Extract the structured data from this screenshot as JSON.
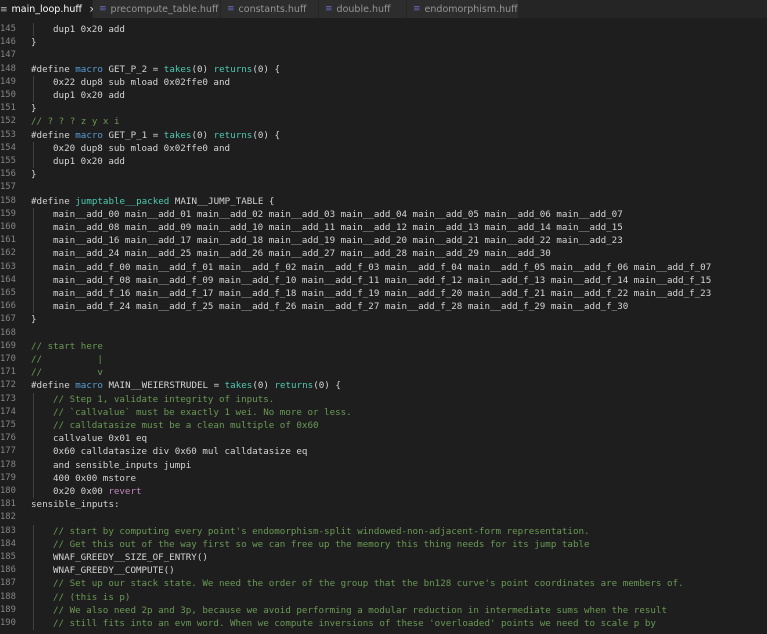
{
  "tabs": [
    {
      "label": "main_loop.huff",
      "active": true,
      "close": "×"
    },
    {
      "label": "precompute_table.huff",
      "active": false
    },
    {
      "label": "constants.huff",
      "active": false
    },
    {
      "label": "double.huff",
      "active": false
    },
    {
      "label": "endomorphism.huff",
      "active": false
    }
  ],
  "colors": {
    "kw": "#569cd6",
    "fn": "#4ec9b0",
    "num": "#b5cea8",
    "com": "#6a9955",
    "rev": "#c586c0",
    "plain": "#d4d4d4"
  },
  "lines": [
    {
      "n": "145",
      "i": 1,
      "t": [
        [
          "p",
          "dup1 0x20 add"
        ]
      ]
    },
    {
      "n": "146",
      "i": 0,
      "t": [
        [
          "p",
          "}"
        ]
      ]
    },
    {
      "n": "147",
      "i": 0,
      "t": []
    },
    {
      "n": "148",
      "i": 0,
      "t": [
        [
          "p",
          "#define "
        ],
        [
          "k",
          "macro"
        ],
        [
          "p",
          " GET_P_2 = "
        ],
        [
          "f",
          "takes"
        ],
        [
          "p",
          "(0) "
        ],
        [
          "f",
          "returns"
        ],
        [
          "p",
          "(0) {"
        ]
      ]
    },
    {
      "n": "149",
      "i": 1,
      "t": [
        [
          "p",
          "0x22 dup8 sub mload 0x02ffe0 and"
        ]
      ]
    },
    {
      "n": "150",
      "i": 1,
      "t": [
        [
          "p",
          "dup1 0x20 add"
        ]
      ]
    },
    {
      "n": "151",
      "i": 0,
      "t": [
        [
          "p",
          "}"
        ]
      ]
    },
    {
      "n": "152",
      "i": 0,
      "t": [
        [
          "c",
          "// ? ? ? z y x i"
        ]
      ]
    },
    {
      "n": "153",
      "i": 0,
      "t": [
        [
          "p",
          "#define "
        ],
        [
          "k",
          "macro"
        ],
        [
          "p",
          " GET_P_1 = "
        ],
        [
          "f",
          "takes"
        ],
        [
          "p",
          "(0) "
        ],
        [
          "f",
          "returns"
        ],
        [
          "p",
          "(0) {"
        ]
      ]
    },
    {
      "n": "154",
      "i": 1,
      "t": [
        [
          "p",
          "0x20 dup8 sub mload 0x02ffe0 and"
        ]
      ]
    },
    {
      "n": "155",
      "i": 1,
      "t": [
        [
          "p",
          "dup1 0x20 add"
        ]
      ]
    },
    {
      "n": "156",
      "i": 0,
      "t": [
        [
          "p",
          "}"
        ]
      ]
    },
    {
      "n": "157",
      "i": 0,
      "t": []
    },
    {
      "n": "158",
      "i": 0,
      "t": [
        [
          "p",
          "#define "
        ],
        [
          "f",
          "jumptable__packed"
        ],
        [
          "p",
          " MAIN__JUMP_TABLE {"
        ]
      ]
    },
    {
      "n": "159",
      "i": 1,
      "t": [
        [
          "p",
          "main__add_00 main__add_01 main__add_02 main__add_03 main__add_04 main__add_05 main__add_06 main__add_07"
        ]
      ]
    },
    {
      "n": "160",
      "i": 1,
      "t": [
        [
          "p",
          "main__add_08 main__add_09 main__add_10 main__add_11 main__add_12 main__add_13 main__add_14 main__add_15"
        ]
      ]
    },
    {
      "n": "161",
      "i": 1,
      "t": [
        [
          "p",
          "main__add_16 main__add_17 main__add_18 main__add_19 main__add_20 main__add_21 main__add_22 main__add_23"
        ]
      ]
    },
    {
      "n": "162",
      "i": 1,
      "t": [
        [
          "p",
          "main__add_24 main__add_25 main__add_26 main__add_27 main__add_28 main__add_29 main__add_30"
        ]
      ]
    },
    {
      "n": "163",
      "i": 1,
      "t": [
        [
          "p",
          "main__add_f_00 main__add_f_01 main__add_f_02 main__add_f_03 main__add_f_04 main__add_f_05 main__add_f_06 main__add_f_07"
        ]
      ]
    },
    {
      "n": "164",
      "i": 1,
      "t": [
        [
          "p",
          "main__add_f_08 main__add_f_09 main__add_f_10 main__add_f_11 main__add_f_12 main__add_f_13 main__add_f_14 main__add_f_15"
        ]
      ]
    },
    {
      "n": "165",
      "i": 1,
      "t": [
        [
          "p",
          "main__add_f_16 main__add_f_17 main__add_f_18 main__add_f_19 main__add_f_20 main__add_f_21 main__add_f_22 main__add_f_23"
        ]
      ]
    },
    {
      "n": "166",
      "i": 1,
      "t": [
        [
          "p",
          "main__add_f_24 main__add_f_25 main__add_f_26 main__add_f_27 main__add_f_28 main__add_f_29 main__add_f_30"
        ]
      ]
    },
    {
      "n": "167",
      "i": 0,
      "t": [
        [
          "p",
          "}"
        ]
      ]
    },
    {
      "n": "168",
      "i": 0,
      "t": []
    },
    {
      "n": "169",
      "i": 0,
      "t": [
        [
          "c",
          "// start here"
        ]
      ]
    },
    {
      "n": "170",
      "i": 0,
      "t": [
        [
          "c",
          "//          |"
        ]
      ]
    },
    {
      "n": "171",
      "i": 0,
      "t": [
        [
          "c",
          "//          v"
        ]
      ]
    },
    {
      "n": "172",
      "i": 0,
      "t": [
        [
          "p",
          "#define "
        ],
        [
          "k",
          "macro"
        ],
        [
          "p",
          " MAIN__WEIERSTRUDEL = "
        ],
        [
          "f",
          "takes"
        ],
        [
          "p",
          "(0) "
        ],
        [
          "f",
          "returns"
        ],
        [
          "p",
          "(0) {"
        ]
      ]
    },
    {
      "n": "173",
      "i": 1,
      "t": [
        [
          "c",
          "// Step 1, validate integrity of inputs."
        ]
      ]
    },
    {
      "n": "174",
      "i": 1,
      "t": [
        [
          "c",
          "// `callvalue` must be exactly 1 wei. No more or less."
        ]
      ]
    },
    {
      "n": "175",
      "i": 1,
      "t": [
        [
          "c",
          "// calldatasize must be a clean multiple of 0x60"
        ]
      ]
    },
    {
      "n": "176",
      "i": 1,
      "t": [
        [
          "p",
          "callvalue 0x01 eq"
        ]
      ]
    },
    {
      "n": "177",
      "i": 1,
      "t": [
        [
          "p",
          "0x60 calldatasize div 0x60 mul calldatasize eq"
        ]
      ]
    },
    {
      "n": "178",
      "i": 1,
      "t": [
        [
          "p",
          "and sensible_inputs jumpi"
        ]
      ]
    },
    {
      "n": "179",
      "i": 1,
      "t": [
        [
          "p",
          "400 0x00 mstore"
        ]
      ]
    },
    {
      "n": "180",
      "i": 1,
      "t": [
        [
          "p",
          "0x20 0x00 "
        ],
        [
          "r",
          "revert"
        ]
      ]
    },
    {
      "n": "181",
      "i": 0,
      "t": [
        [
          "p",
          "sensible_inputs:"
        ]
      ]
    },
    {
      "n": "182",
      "i": 0,
      "t": []
    },
    {
      "n": "183",
      "i": 1,
      "t": [
        [
          "c",
          "// start by computing every point's endomorphism-split windowed-non-adjacent-form representation."
        ]
      ]
    },
    {
      "n": "184",
      "i": 1,
      "t": [
        [
          "c",
          "// Get this out of the way first so we can free up the memory this thing needs for its jump table"
        ]
      ]
    },
    {
      "n": "185",
      "i": 1,
      "t": [
        [
          "p",
          "WNAF_GREEDY__SIZE_OF_ENTRY()"
        ]
      ]
    },
    {
      "n": "186",
      "i": 1,
      "t": [
        [
          "p",
          "WNAF_GREEDY__COMPUTE()"
        ]
      ]
    },
    {
      "n": "187",
      "i": 1,
      "t": [
        [
          "c",
          "// Set up our stack state. We need the order of the group that the bn128 curve's point coordinates are members of."
        ]
      ]
    },
    {
      "n": "188",
      "i": 1,
      "t": [
        [
          "c",
          "// (this is p)"
        ]
      ]
    },
    {
      "n": "189",
      "i": 1,
      "t": [
        [
          "c",
          "// We also need 2p and 3p, because we avoid performing a modular reduction in intermediate sums when the result"
        ]
      ]
    },
    {
      "n": "190",
      "i": 1,
      "t": [
        [
          "c",
          "// still fits into an evm word. When we compute inversions of these 'overloaded' points we need to scale p by"
        ]
      ]
    }
  ]
}
